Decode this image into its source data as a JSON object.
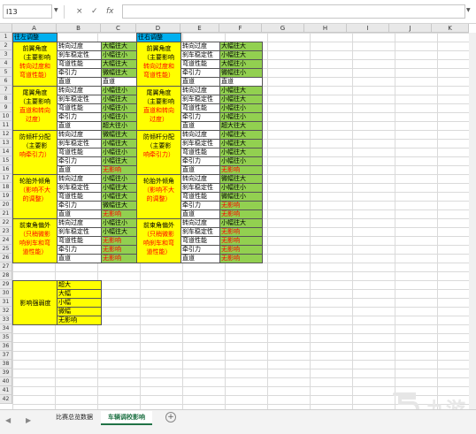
{
  "formula_bar": {
    "name_box": "I13",
    "cancel": "×",
    "enter": "✓",
    "fx": "fx",
    "formula": ""
  },
  "columns": [
    "A",
    "B",
    "C",
    "D",
    "E",
    "F",
    "G",
    "H",
    "I",
    "J",
    "K"
  ],
  "rows": [
    "1",
    "2",
    "3",
    "4",
    "5",
    "6",
    "7",
    "8",
    "9",
    "10",
    "11",
    "12",
    "13",
    "14",
    "15",
    "16",
    "17",
    "18",
    "19",
    "20",
    "21",
    "22",
    "23",
    "24",
    "25",
    "26",
    "27",
    "28",
    "29",
    "30",
    "31",
    "32",
    "33",
    "34",
    "35",
    "36",
    "37",
    "38",
    "39",
    "40",
    "41",
    "42"
  ],
  "headers": {
    "left": "往左调整",
    "right": "往右调整"
  },
  "items": [
    "转向过度",
    "刹车稳定性",
    "弯道性能",
    "牵引力",
    "直道"
  ],
  "groups": [
    {
      "left_title": [
        "前翼角度",
        "（主要影响"
      ],
      "left_red": [
        "转向过度和",
        "弯道性能）"
      ],
      "left_vals": [
        "大幅往大",
        "小幅往小",
        "大幅往大",
        "微幅往大",
        "直道"
      ],
      "right_title": [
        "前翼角度",
        "（主要影响"
      ],
      "right_red": [
        "转向过度和",
        "弯道性能）"
      ],
      "right_vals": [
        "大幅往大",
        "小幅往大",
        "大幅往小",
        "微幅往小",
        "直道"
      ]
    },
    {
      "left_title": [
        "尾翼角度",
        "（主要影响"
      ],
      "left_red": [
        "直道和转向",
        "过度）"
      ],
      "left_vals": [
        "小幅往小",
        "小幅往大",
        "小幅往小",
        "小幅往小",
        "超大往小"
      ],
      "right_title": [
        "尾翼角度",
        "（主要影响"
      ],
      "right_red": [
        "直道和转向",
        "过度）"
      ],
      "right_vals": [
        "小幅往大",
        "小幅往大",
        "小幅往小",
        "小幅往小",
        "超大往大"
      ]
    },
    {
      "left_title": [
        "防倾杆分配",
        "（主要影"
      ],
      "left_red": [
        "响牵引力）"
      ],
      "left_vals": [
        "微幅往大",
        "小幅往大",
        "小幅往小",
        "小幅往大",
        "无影响"
      ],
      "right_title": [
        "防倾杆分配",
        "（主要影"
      ],
      "right_red": [
        "响牵引力）"
      ],
      "right_vals": [
        "小幅往大",
        "小幅往大",
        "小幅往大",
        "小幅往小",
        "无影响"
      ]
    },
    {
      "left_title": [
        "轮胎外倾角"
      ],
      "left_red": [
        "（影响不大",
        "的调整）"
      ],
      "left_vals": [
        "小幅往小",
        "小幅往大",
        "小幅往大",
        "微幅往大",
        "无影响"
      ],
      "right_title": [
        "轮胎外倾角"
      ],
      "right_red": [
        "（影响不大",
        "的调整）"
      ],
      "right_vals": [
        "微幅往大",
        "小幅往小",
        "微幅往小",
        "无影响",
        "无影响"
      ]
    },
    {
      "left_title": [
        "前束角偏外"
      ],
      "left_red": [
        "（只稍微影",
        "响刹车和弯",
        "道性能）"
      ],
      "left_vals": [
        "小幅往小",
        "小幅往大",
        "无影响",
        "无影响",
        "无影响"
      ],
      "right_title": [
        "前束角偏外"
      ],
      "right_red": [
        "（只稍微影",
        "响刹车和弯",
        "道性能）"
      ],
      "right_vals": [
        "小幅往大",
        "无影响",
        "无影响",
        "无影响",
        "无影响"
      ]
    }
  ],
  "legend": {
    "label": "影响强弱度",
    "levels": [
      "超大",
      "大幅",
      "小幅",
      "微幅",
      "无影响"
    ]
  },
  "sheet_tabs": [
    {
      "label": "比赛总览数据",
      "active": false
    },
    {
      "label": "车辆调校影响",
      "active": true
    }
  ],
  "add_sheet": "+",
  "watermark": "九游"
}
